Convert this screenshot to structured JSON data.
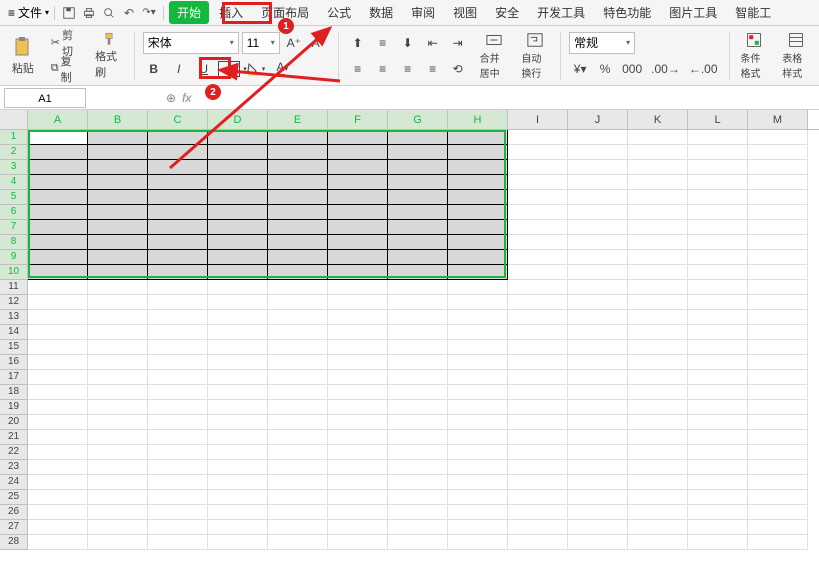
{
  "menubar": {
    "file": "文件",
    "tabs": [
      "开始",
      "插入",
      "页面布局",
      "公式",
      "数据",
      "审阅",
      "视图",
      "安全",
      "开发工具",
      "特色功能",
      "图片工具",
      "智能工"
    ]
  },
  "ribbon": {
    "paste": "粘贴",
    "cut": "剪切",
    "copy": "复制",
    "format_painter": "格式刷",
    "font_name": "宋体",
    "font_size": "11",
    "merge_center": "合并居中",
    "wrap_text": "自动换行",
    "number_format": "常规",
    "cond_format": "条件格式",
    "table_style": "表格样式"
  },
  "namebox": {
    "cell_ref": "A1",
    "fx": "fx"
  },
  "columns": [
    "A",
    "B",
    "C",
    "D",
    "E",
    "F",
    "G",
    "H",
    "I",
    "J",
    "K",
    "L",
    "M"
  ],
  "rows": [
    "1",
    "2",
    "3",
    "4",
    "5",
    "6",
    "7",
    "8",
    "9",
    "10",
    "11",
    "12",
    "13",
    "14",
    "15",
    "16",
    "17",
    "18",
    "19",
    "20",
    "21",
    "22",
    "23",
    "24",
    "25",
    "26",
    "27",
    "28"
  ],
  "selection": {
    "cols": 8,
    "rows": 10
  },
  "annotations": {
    "badge1": "1",
    "badge2": "2"
  }
}
